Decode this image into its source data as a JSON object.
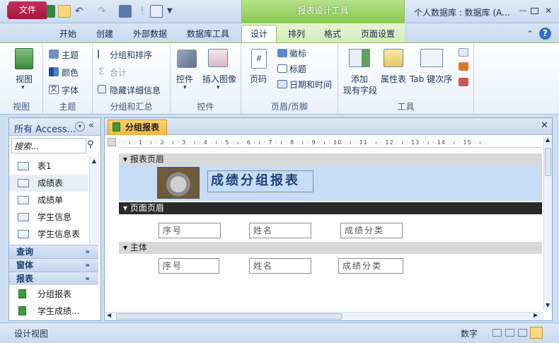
{
  "app": {
    "window_title": "个人数据库 : 数据库 (A...",
    "context_tool_title": "报表设计工具"
  },
  "tabs": [
    "文件",
    "开始",
    "创建",
    "外部数据",
    "数据库工具",
    "设计",
    "排列",
    "格式",
    "页面设置"
  ],
  "ribbon": {
    "view": {
      "label": "视图",
      "group": "视图"
    },
    "theme": {
      "items": [
        "主题",
        "颜色",
        "字体"
      ],
      "group": "主题"
    },
    "grouping": {
      "items": [
        "分组和排序",
        "合计",
        "隐藏详细信息"
      ],
      "group": "分组和汇总"
    },
    "controls": {
      "items": [
        "控件",
        "插入图像"
      ],
      "group": "控件"
    },
    "header_footer": {
      "page_num": "页码",
      "items": [
        "徽标",
        "标题",
        "日期和时间"
      ],
      "group": "页眉/页脚"
    },
    "tools": {
      "add_field_1": "添加",
      "add_field_2": "现有字段",
      "property_sheet": "属性表",
      "tab_order": "Tab 键次序",
      "group": "工具"
    }
  },
  "nav": {
    "header": "所有 Access...",
    "search_placeholder": "搜索...",
    "tables": [
      "表1",
      "成绩表",
      "成绩单",
      "学生信息",
      "学生信息表"
    ],
    "categories": {
      "query": "查询",
      "form": "窗体",
      "report": "报表"
    },
    "reports": [
      "分组报表",
      "学生成绩..."
    ]
  },
  "document": {
    "tab_title": "分组报表",
    "ruler": "· · ı · 1 · ı · 2 · ı · 3 · ı · 4 · ı · 5 · ı · 6 · ı · 7 · ı · 8 · ı · 9 · ı · 10 · ı · 11 · ı · 12 · ı · 13 · ı · 14 · ı · 15 · ı ·",
    "sections": {
      "report_header": "报表页眉",
      "page_header": "页面页眉",
      "detail": "主体"
    },
    "report_title": "成绩分组报表",
    "page_header_fields": [
      "序号",
      "姓名",
      "成绩分类"
    ],
    "detail_fields": [
      "序号",
      "姓名",
      "成绩分类"
    ]
  },
  "status": {
    "left": "设计视图",
    "right": "数字"
  },
  "colors": {
    "accent_file": "#b81d48",
    "context_green": "#86c94f",
    "report_header_bg": "#c6dcf7",
    "doc_tab": "#f2b640"
  }
}
